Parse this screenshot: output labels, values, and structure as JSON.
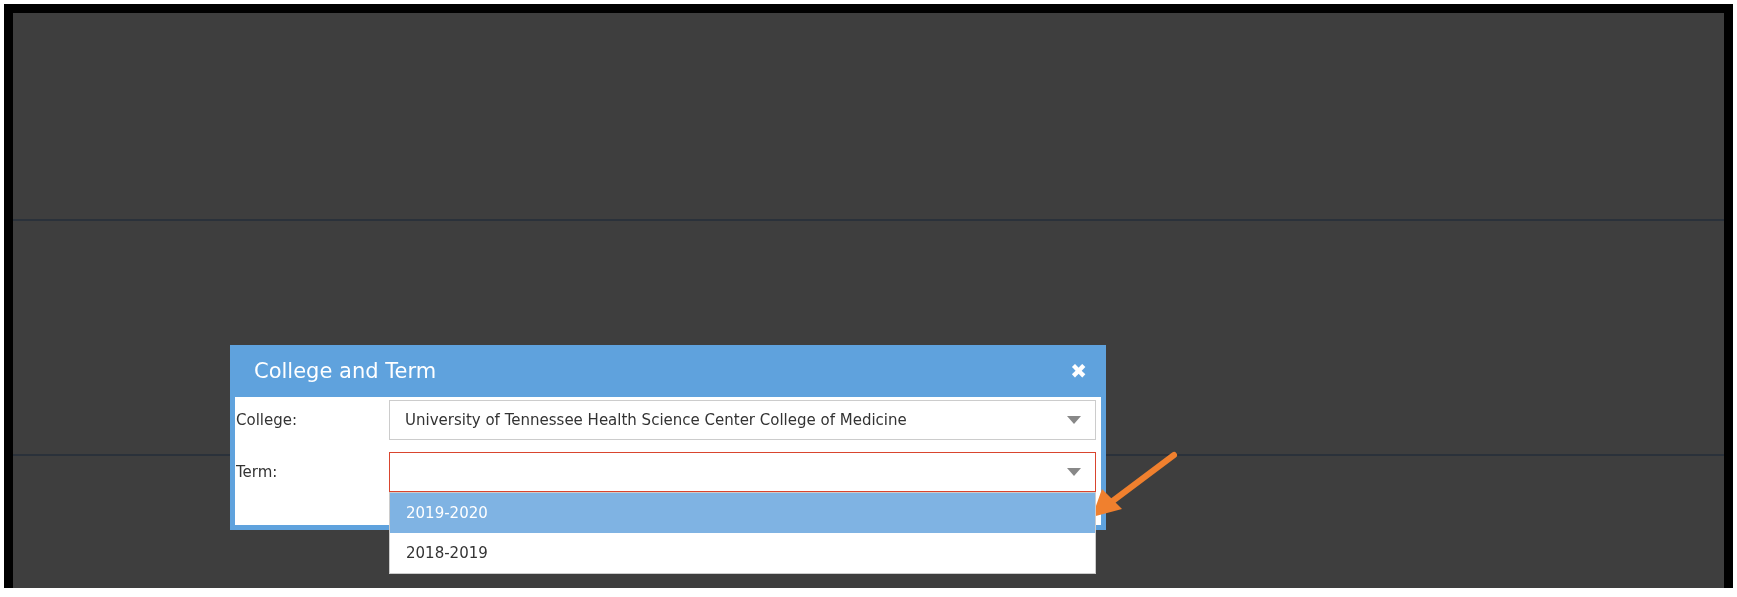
{
  "dialog": {
    "title": "College and Term",
    "close": "✖",
    "fields": [
      {
        "label": "College:",
        "value": "University of Tennessee Health Science Center College of Medicine",
        "invalid": false,
        "open": false
      },
      {
        "label": "Term:",
        "invalid": true,
        "open": true
      }
    ],
    "options": [
      {
        "label": "2019-2020",
        "selected": true
      },
      {
        "label": "2018-2019",
        "selected": false
      }
    ]
  }
}
